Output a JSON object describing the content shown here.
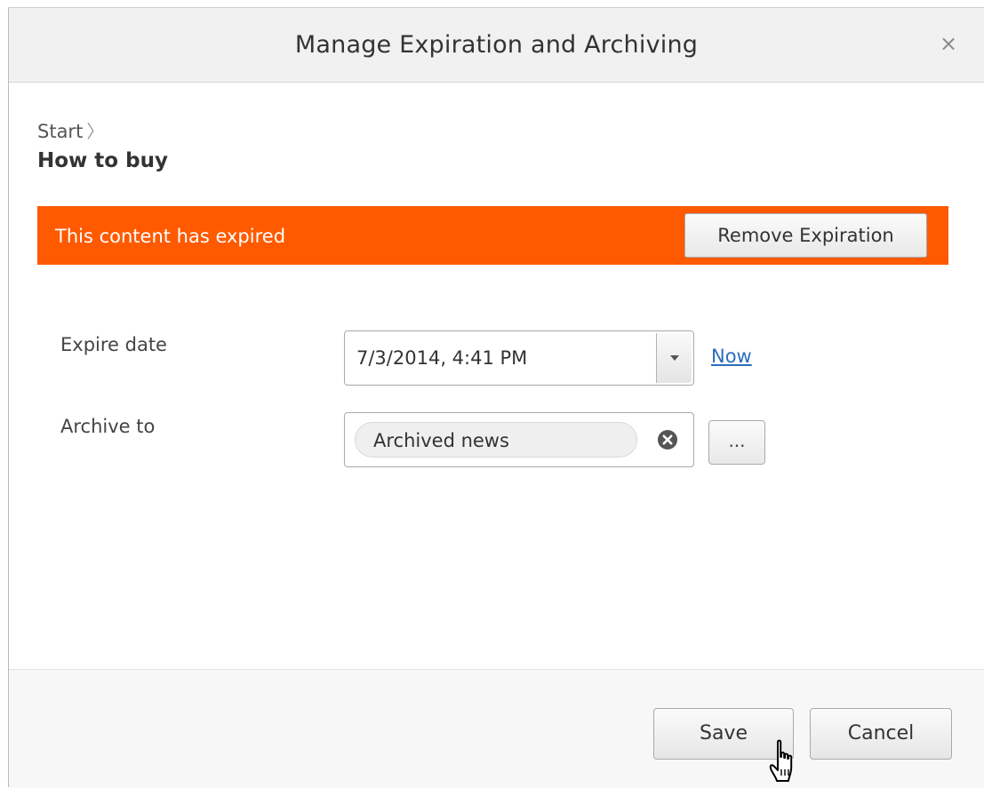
{
  "dialog": {
    "title": "Manage Expiration and Archiving",
    "close_glyph": "×"
  },
  "breadcrumb": {
    "parent": "Start",
    "separator": "〉",
    "current": "How to buy"
  },
  "alert": {
    "message": "This content has expired",
    "button_label": "Remove Expiration",
    "color": "#ff5a00"
  },
  "fields": {
    "expire_date": {
      "label": "Expire date",
      "value": "7/3/2014, 4:41 PM",
      "now_link": "Now"
    },
    "archive_to": {
      "label": "Archive to",
      "value": "Archived news",
      "browse_label": "..."
    }
  },
  "footer": {
    "save_label": "Save",
    "cancel_label": "Cancel"
  },
  "icons": {
    "close": "close-icon",
    "dropdown": "chevron-down-icon",
    "clear": "clear-circle-icon",
    "cursor": "hand-pointer-icon"
  }
}
